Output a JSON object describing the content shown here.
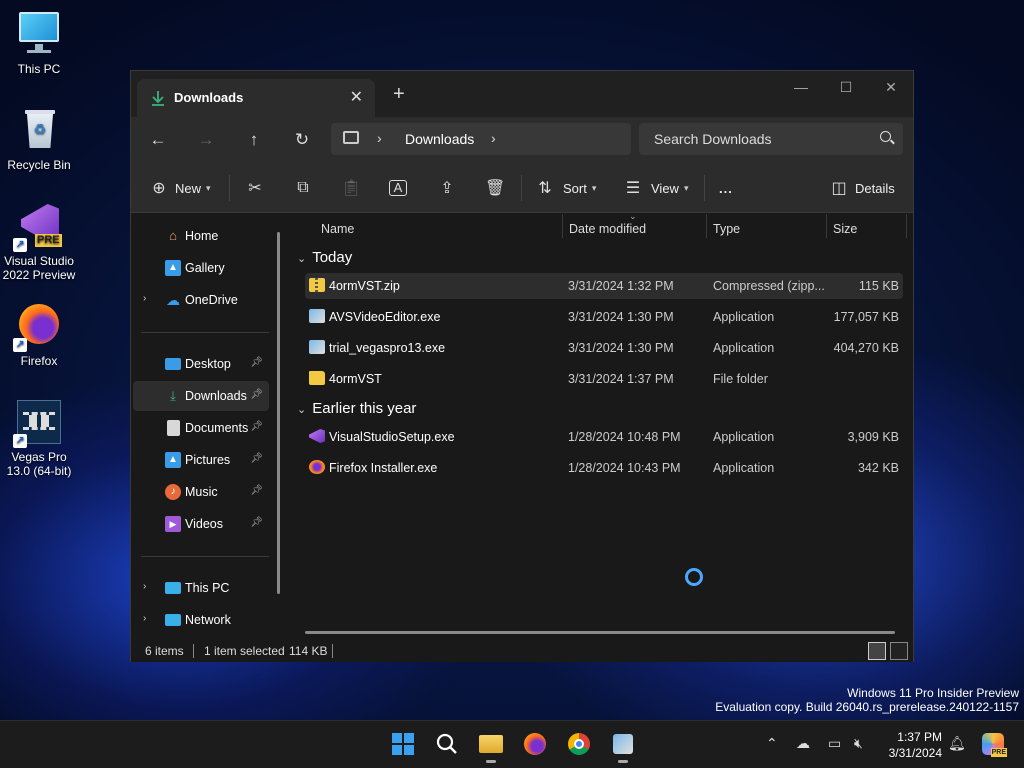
{
  "desktop": {
    "icons": [
      {
        "label": "This PC"
      },
      {
        "label": "Recycle Bin"
      },
      {
        "label": "Visual Studio 2022 Preview",
        "badge": "PRE"
      },
      {
        "label": "Firefox"
      },
      {
        "label": "Vegas Pro 13.0 (64-bit)"
      }
    ]
  },
  "explorer": {
    "tab_title": "Downloads",
    "address": {
      "crumb": "Downloads"
    },
    "search_placeholder": "Search Downloads",
    "toolbar": {
      "new_label": "New",
      "sort_label": "Sort",
      "view_label": "View",
      "more_label": "...",
      "details_label": "Details"
    },
    "nav": {
      "items": [
        {
          "label": "Home"
        },
        {
          "label": "Gallery"
        },
        {
          "label": "OneDrive"
        },
        {
          "label": "Desktop"
        },
        {
          "label": "Downloads"
        },
        {
          "label": "Documents"
        },
        {
          "label": "Pictures"
        },
        {
          "label": "Music"
        },
        {
          "label": "Videos"
        },
        {
          "label": "This PC"
        },
        {
          "label": "Network"
        }
      ]
    },
    "columns": {
      "name": "Name",
      "date": "Date modified",
      "type": "Type",
      "size": "Size"
    },
    "groups": [
      {
        "label": "Today",
        "files": [
          {
            "name": "4ormVST.zip",
            "date": "3/31/2024 1:32 PM",
            "type": "Compressed (zipp...",
            "size": "115 KB"
          },
          {
            "name": "AVSVideoEditor.exe",
            "date": "3/31/2024 1:30 PM",
            "type": "Application",
            "size": "177,057 KB"
          },
          {
            "name": "trial_vegaspro13.exe",
            "date": "3/31/2024 1:30 PM",
            "type": "Application",
            "size": "404,270 KB"
          },
          {
            "name": "4ormVST",
            "date": "3/31/2024 1:37 PM",
            "type": "File folder",
            "size": ""
          }
        ]
      },
      {
        "label": "Earlier this year",
        "files": [
          {
            "name": "VisualStudioSetup.exe",
            "date": "1/28/2024 10:48 PM",
            "type": "Application",
            "size": "3,909 KB"
          },
          {
            "name": "Firefox Installer.exe",
            "date": "1/28/2024 10:43 PM",
            "type": "Application",
            "size": "342 KB"
          }
        ]
      }
    ],
    "status": {
      "count": "6 items",
      "selection": "1 item selected",
      "size": "114 KB"
    }
  },
  "watermark": {
    "line1": "Windows 11 Pro Insider Preview",
    "line2": "Evaluation copy. Build 26040.rs_prerelease.240122-1157"
  },
  "taskbar": {
    "time": "1:37 PM",
    "date": "3/31/2024",
    "copilot_badge": "PRE"
  },
  "colors": {
    "accent": "#4aa8ff",
    "downloads_green": "#3bb27c",
    "folder_yellow": "#f3c842"
  }
}
